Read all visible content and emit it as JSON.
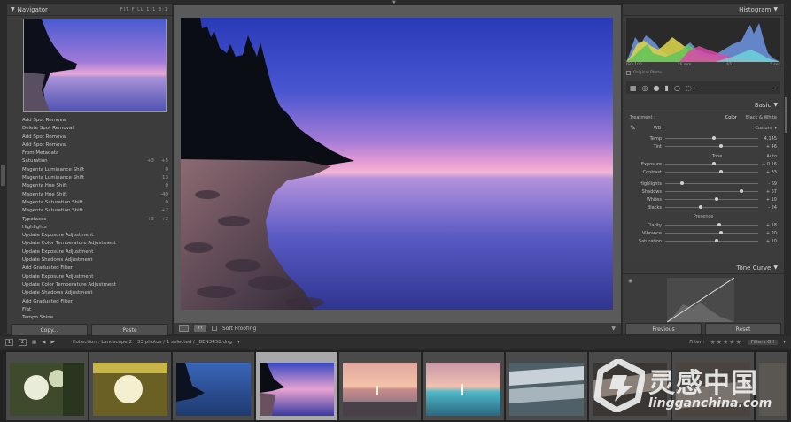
{
  "navigator": {
    "title": "Navigator",
    "zoom_levels": "FIT  FILL  1:1  3:1"
  },
  "history": [
    {
      "label": "Add Spot Removal",
      "v1": "",
      "v2": ""
    },
    {
      "label": "Delete Spot Removal",
      "v1": "",
      "v2": ""
    },
    {
      "label": "Add Spot Removal",
      "v1": "",
      "v2": ""
    },
    {
      "label": "Add Spot Removal",
      "v1": "",
      "v2": ""
    },
    {
      "label": "From Metadata",
      "v1": "",
      "v2": ""
    },
    {
      "label": "Saturation",
      "v1": "+3",
      "v2": "+5"
    },
    {
      "label": "Magenta Luminance Shift",
      "v1": "",
      "v2": "0"
    },
    {
      "label": "Magenta Luminance Shift",
      "v1": "",
      "v2": "13"
    },
    {
      "label": "Magenta Hue Shift",
      "v1": "",
      "v2": "0"
    },
    {
      "label": "Magenta Hue Shift",
      "v1": "",
      "v2": "-40"
    },
    {
      "label": "Magenta Saturation Shift",
      "v1": "",
      "v2": "0"
    },
    {
      "label": "Magenta Saturation Shift",
      "v1": "",
      "v2": "+2"
    },
    {
      "label": "Typefaces",
      "v1": "+3",
      "v2": "+2"
    },
    {
      "label": "Highlights",
      "v1": "",
      "v2": ""
    },
    {
      "label": "Update Exposure Adjustment",
      "v1": "",
      "v2": ""
    },
    {
      "label": "Update Color Temperature Adjustment",
      "v1": "",
      "v2": ""
    },
    {
      "label": "Update Exposure Adjustment",
      "v1": "",
      "v2": ""
    },
    {
      "label": "Update Shadows Adjustment",
      "v1": "",
      "v2": ""
    },
    {
      "label": "Add Graduated Filter",
      "v1": "",
      "v2": ""
    },
    {
      "label": "Update Exposure Adjustment",
      "v1": "",
      "v2": ""
    },
    {
      "label": "Update Color Temperature Adjustment",
      "v1": "",
      "v2": ""
    },
    {
      "label": "Update Shadows Adjustment",
      "v1": "",
      "v2": ""
    },
    {
      "label": "Add Graduated Filter",
      "v1": "",
      "v2": ""
    },
    {
      "label": "Flat",
      "v1": "",
      "v2": ""
    },
    {
      "label": "Tempo Shine",
      "v1": "",
      "v2": ""
    }
  ],
  "left_buttons": {
    "copy": "Copy...",
    "paste": "Paste"
  },
  "toolbar": {
    "zoom": "YY",
    "soft_proofing": "Soft Proofing"
  },
  "histogram": {
    "title": "Histogram",
    "iso": "ISO 100",
    "focal": "16 mm",
    "aperture": "f/11",
    "shutter": "5 sec",
    "original_photo": "Original Photo"
  },
  "basic": {
    "title": "Basic",
    "treatment_label": "Treatment :",
    "color": "Color",
    "bw": "Black & White",
    "wb_label": "WB :",
    "wb_value": "Custom",
    "temp": {
      "label": "Temp",
      "value": "4,145",
      "pos": 0.52
    },
    "tint": {
      "label": "Tint",
      "value": "+ 46",
      "pos": 0.6
    },
    "tone": "Tone",
    "auto": "Auto",
    "exposure": {
      "label": "Exposure",
      "value": "+ 0.16",
      "pos": 0.52
    },
    "contrast": {
      "label": "Contrast",
      "value": "+ 33",
      "pos": 0.6
    },
    "highlights": {
      "label": "Highlights",
      "value": "- 69",
      "pos": 0.18
    },
    "shadows": {
      "label": "Shadows",
      "value": "+ 67",
      "pos": 0.82
    },
    "whites": {
      "label": "Whites",
      "value": "+ 10",
      "pos": 0.55
    },
    "blacks": {
      "label": "Blacks",
      "value": "- 24",
      "pos": 0.38
    },
    "presence": "Presence",
    "clarity": {
      "label": "Clarity",
      "value": "+ 18",
      "pos": 0.58
    },
    "vibrance": {
      "label": "Vibrance",
      "value": "+ 20",
      "pos": 0.6
    },
    "saturation": {
      "label": "Saturation",
      "value": "+ 10",
      "pos": 0.55
    }
  },
  "tone_curve": {
    "title": "Tone Curve"
  },
  "right_buttons": {
    "previous": "Previous",
    "reset": "Reset"
  },
  "film_bar": {
    "page1": "1",
    "page2": "2",
    "collection": "Collection : Landscape 2",
    "count": "33 photos / 1 selected / _BEN3458.dng",
    "filter_label": "Filter :",
    "filters_off": "Filters Off"
  },
  "watermark": {
    "cn": "灵感中国",
    "url": "lingganchina.com"
  },
  "colors": {
    "panel": "#3c3c3c",
    "background": "#2a2a2a",
    "selected_cell": "#a8a8a8"
  }
}
